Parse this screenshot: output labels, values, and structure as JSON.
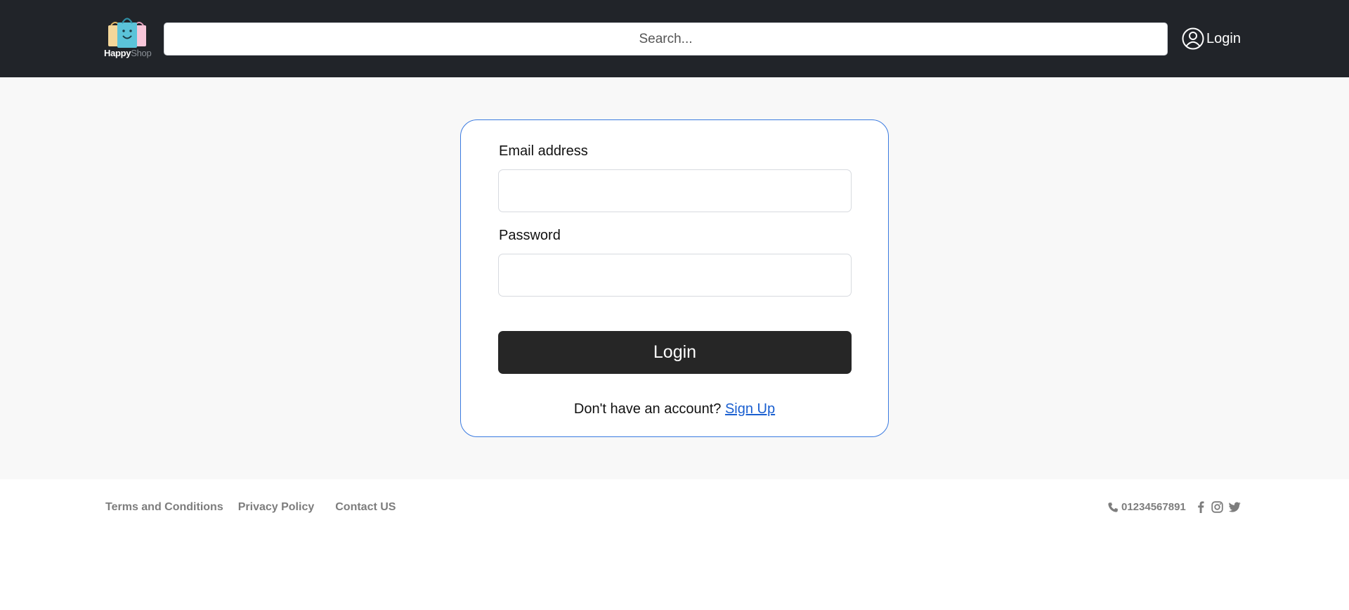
{
  "header": {
    "logo": {
      "word1": "Happy",
      "word2": "Shop",
      "colors": [
        "#f4d79a",
        "#5bc3d9",
        "#f7c6d9"
      ]
    },
    "search": {
      "placeholder": "Search...",
      "value": ""
    },
    "login_label": "Login"
  },
  "form": {
    "email_label": "Email address",
    "email_value": "",
    "password_label": "Password",
    "password_value": "",
    "submit_label": "Login",
    "signup_prompt": "Don't have an account?",
    "signup_link": "Sign Up"
  },
  "footer": {
    "links": [
      "Terms and Conditions",
      "Privacy Policy",
      "Contact US"
    ],
    "phone": "01234567891",
    "social_icons": [
      "facebook-icon",
      "instagram-icon",
      "twitter-icon"
    ]
  },
  "colors": {
    "header_bg": "#212429",
    "card_border": "#3a7ae0",
    "button_bg": "#262626",
    "link": "#1a5fd0",
    "footer_text": "#7d7d7d"
  }
}
